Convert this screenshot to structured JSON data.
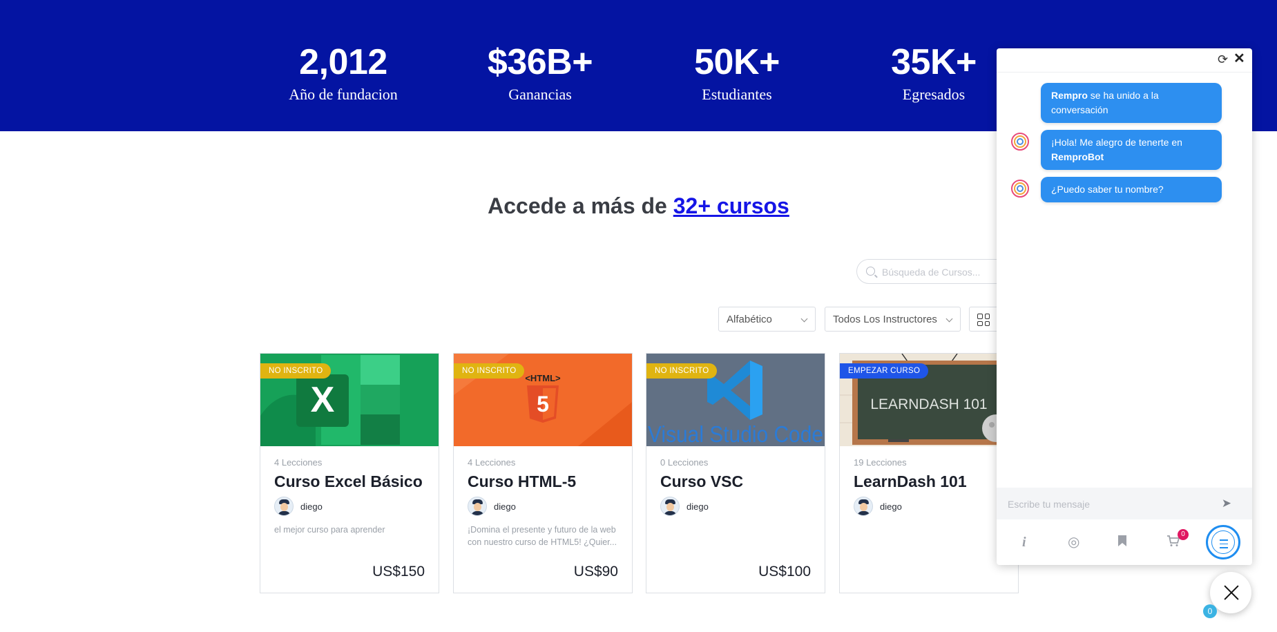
{
  "stats": [
    {
      "value": "2,012",
      "label": "Año de fundacion"
    },
    {
      "value": "$36B+",
      "label": "Ganancias"
    },
    {
      "value": "50K+",
      "label": "Estudiantes"
    },
    {
      "value": "35K+",
      "label": "Egresados"
    }
  ],
  "heading": {
    "prefix": "Accede a más de ",
    "link": "32+ cursos"
  },
  "filters": {
    "search_placeholder": "Búsqueda de Cursos...",
    "sort_selected": "Alfabético",
    "instructor_selected": "Todos Los Instructores",
    "view": "grid-icon"
  },
  "courses": [
    {
      "badge": "NO INSCRITO",
      "lessons": "4 Lecciones",
      "title": "Curso Excel Básico",
      "author": "diego",
      "description": "el mejor curso para aprender",
      "price": "US$150"
    },
    {
      "badge": "NO INSCRITO",
      "lessons": "4 Lecciones",
      "title": "Curso HTML-5",
      "author": "diego",
      "description": "¡Domina el presente y futuro de la web con nuestro curso de HTML5! ¿Quier...",
      "price": "US$90",
      "thumb_text": "<HTML>"
    },
    {
      "badge": "NO INSCRITO",
      "lessons": "0 Lecciones",
      "title": "Curso VSC",
      "author": "diego",
      "description": "",
      "price": "US$100",
      "thumb_text": "Visual Studio Code"
    },
    {
      "badge": "EMPEZAR CURSO",
      "lessons": "19 Lecciones",
      "title": "LearnDash 101",
      "author": "diego",
      "description": "",
      "price": "",
      "thumb_text": "LEARNDASH 101"
    }
  ],
  "colors": {
    "banner": "#0414a2",
    "badge_yellow": "#e0b411",
    "badge_blue": "#1f55e8",
    "chat_bubble": "#2d8ff0"
  },
  "chat": {
    "messages": [
      {
        "bold": "Rempro",
        "text": " se ha unido a la conversación"
      },
      {
        "text": "¡Hola! Me alegro de tenerte en ",
        "bold": "RemproBot"
      },
      {
        "text": "¿Puedo saber tu nombre?"
      }
    ],
    "input_placeholder": "Escribe tu mensaje",
    "cart_count": "0",
    "fab_count": "0"
  }
}
